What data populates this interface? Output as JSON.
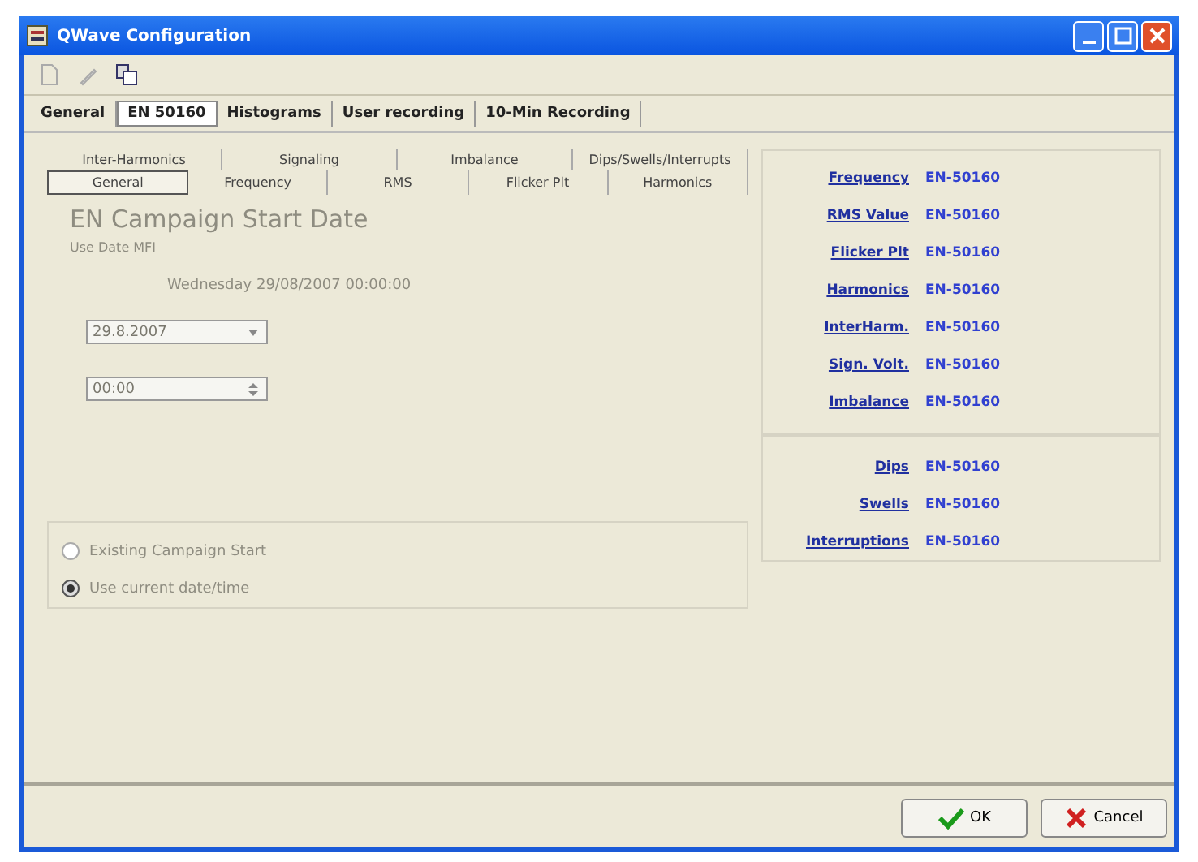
{
  "window": {
    "title": "QWave Configuration"
  },
  "main_tabs": [
    {
      "label": "General",
      "selected": false
    },
    {
      "label": "EN 50160",
      "selected": true
    },
    {
      "label": "Histograms",
      "selected": false
    },
    {
      "label": "User recording",
      "selected": false
    },
    {
      "label": "10-Min Recording",
      "selected": false
    }
  ],
  "sub_tabs_row_1": [
    {
      "label": "Inter-Harmonics",
      "selected": false
    },
    {
      "label": "Signaling",
      "selected": false
    },
    {
      "label": "Imbalance",
      "selected": false
    },
    {
      "label": "Dips/Swells/Interrupts",
      "selected": false
    }
  ],
  "sub_tabs_row_2": [
    {
      "label": "General",
      "selected": true
    },
    {
      "label": "Frequency",
      "selected": false
    },
    {
      "label": "RMS",
      "selected": false
    },
    {
      "label": "Flicker Plt",
      "selected": false
    },
    {
      "label": "Harmonics",
      "selected": false
    }
  ],
  "general": {
    "heading": "EN Campaign Start Date",
    "subheading": "Use Date MFI",
    "date_text": "Wednesday 29/08/2007 00:00:00",
    "date_field": {
      "value": "29.8.2007",
      "disabled": true
    },
    "time_field": {
      "value": "00:00",
      "disabled": true
    },
    "radios": [
      {
        "label": "Existing Campaign Start",
        "selected": false,
        "disabled": true
      },
      {
        "label": "Use current date/time",
        "selected": true,
        "disabled": true
      }
    ]
  },
  "links_top": [
    {
      "label": "Frequency",
      "value": "EN-50160"
    },
    {
      "label": "RMS Value",
      "value": "EN-50160"
    },
    {
      "label": "Flicker Plt",
      "value": "EN-50160"
    },
    {
      "label": "Harmonics",
      "value": "EN-50160"
    },
    {
      "label": "InterHarm.",
      "value": "EN-50160"
    },
    {
      "label": "Sign. Volt.",
      "value": "EN-50160"
    },
    {
      "label": "Imbalance",
      "value": "EN-50160"
    }
  ],
  "links_bottom": [
    {
      "label": "Dips",
      "value": "EN-50160"
    },
    {
      "label": "Swells",
      "value": "EN-50160"
    },
    {
      "label": "Interruptions",
      "value": "EN-50160"
    }
  ],
  "buttons": [
    {
      "kind": "ok",
      "label": "OK"
    },
    {
      "kind": "cancel",
      "label": "Cancel"
    }
  ]
}
